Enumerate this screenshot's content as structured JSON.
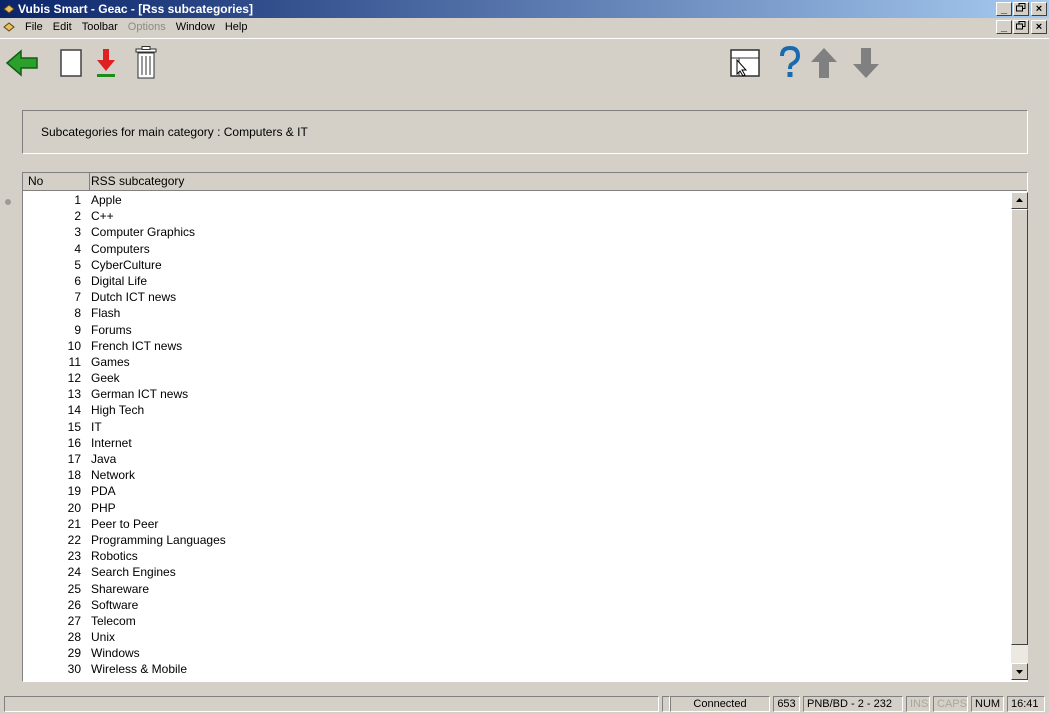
{
  "window": {
    "title": "Vubis Smart - Geac - [Rss subcategories]",
    "controls": {
      "minimize": "_",
      "restore": "8",
      "close": "×"
    }
  },
  "menu": [
    {
      "label": "File",
      "enabled": true
    },
    {
      "label": "Edit",
      "enabled": true
    },
    {
      "label": "Toolbar",
      "enabled": true
    },
    {
      "label": "Options",
      "enabled": false
    },
    {
      "label": "Window",
      "enabled": true
    },
    {
      "label": "Help",
      "enabled": true
    }
  ],
  "toolbar": {
    "buttons": [
      "back-arrow-icon",
      "new-record-icon",
      "download-icon",
      "delete-trash-icon",
      "layout-view-icon",
      "help-icon",
      "move-up-icon",
      "move-down-icon"
    ]
  },
  "panel": {
    "label": "Subcategories for main category : Computers & IT"
  },
  "grid": {
    "columns": [
      "No",
      "RSS subcategory"
    ],
    "rows": [
      {
        "no": "1",
        "name": "Apple"
      },
      {
        "no": "2",
        "name": "C++"
      },
      {
        "no": "3",
        "name": "Computer Graphics"
      },
      {
        "no": "4",
        "name": "Computers"
      },
      {
        "no": "5",
        "name": "CyberCulture"
      },
      {
        "no": "6",
        "name": "Digital Life"
      },
      {
        "no": "7",
        "name": "Dutch ICT news"
      },
      {
        "no": "8",
        "name": "Flash"
      },
      {
        "no": "9",
        "name": "Forums"
      },
      {
        "no": "10",
        "name": "French ICT news"
      },
      {
        "no": "11",
        "name": "Games"
      },
      {
        "no": "12",
        "name": "Geek"
      },
      {
        "no": "13",
        "name": "German ICT news"
      },
      {
        "no": "14",
        "name": "High Tech"
      },
      {
        "no": "15",
        "name": "IT"
      },
      {
        "no": "16",
        "name": "Internet"
      },
      {
        "no": "17",
        "name": "Java"
      },
      {
        "no": "18",
        "name": "Network"
      },
      {
        "no": "19",
        "name": "PDA"
      },
      {
        "no": "20",
        "name": "PHP"
      },
      {
        "no": "21",
        "name": "Peer to Peer"
      },
      {
        "no": "22",
        "name": "Programming Languages"
      },
      {
        "no": "23",
        "name": "Robotics"
      },
      {
        "no": "24",
        "name": "Search Engines"
      },
      {
        "no": "25",
        "name": "Shareware"
      },
      {
        "no": "26",
        "name": "Software"
      },
      {
        "no": "27",
        "name": "Telecom"
      },
      {
        "no": "28",
        "name": "Unix"
      },
      {
        "no": "29",
        "name": "Windows"
      },
      {
        "no": "30",
        "name": "Wireless & Mobile"
      }
    ]
  },
  "status": {
    "connection": "Connected",
    "count": "653",
    "location": "PNB/BD - 2 - 232",
    "ins": "INS",
    "caps": "CAPS",
    "num": "NUM",
    "time": "16:41"
  }
}
